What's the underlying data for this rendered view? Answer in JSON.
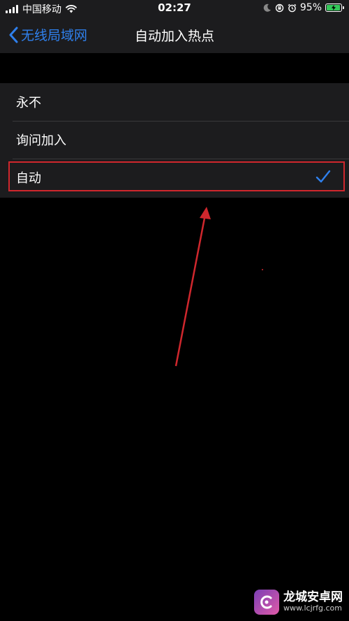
{
  "status_bar": {
    "carrier": "中国移动",
    "time": "02:27",
    "battery_percent": "95%",
    "battery_level": 0.95,
    "icons": [
      "signal-icon",
      "wifi-icon",
      "moon-icon",
      "rotation-lock-icon",
      "alarm-icon",
      "battery-icon"
    ]
  },
  "nav": {
    "back_label": "无线局域网",
    "title": "自动加入热点"
  },
  "options": [
    {
      "label": "永不",
      "selected": false
    },
    {
      "label": "询问加入",
      "selected": false
    },
    {
      "label": "自动",
      "selected": true
    }
  ],
  "colors": {
    "accent": "#2f80ed",
    "background": "#000000",
    "cell": "#1c1c1e",
    "annotation": "#d0272d"
  },
  "watermark": {
    "title": "龙城安卓网",
    "url": "www.lcjrfg.com"
  }
}
